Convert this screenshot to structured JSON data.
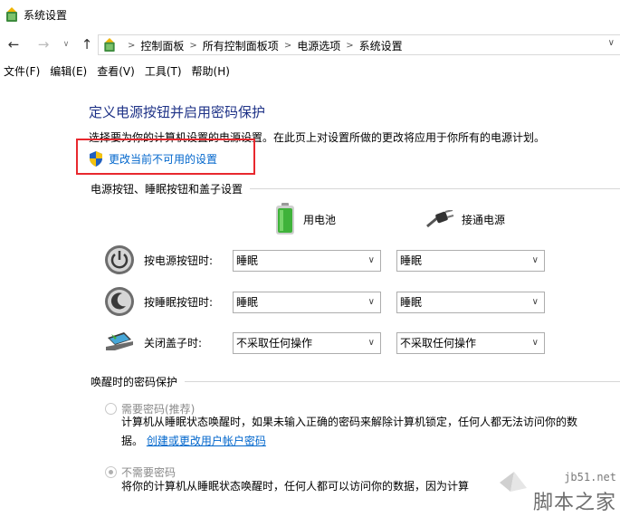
{
  "window": {
    "title": "系统设置"
  },
  "nav": {
    "back": "←",
    "forward": "→",
    "recent": "∨",
    "up": "↑"
  },
  "address": {
    "crumbs": [
      "控制面板",
      "所有控制面板项",
      "电源选项",
      "系统设置"
    ],
    "separator": ">",
    "dropdown": "∨"
  },
  "menu": [
    "文件(F)",
    "编辑(E)",
    "查看(V)",
    "工具(T)",
    "帮助(H)"
  ],
  "page": {
    "title": "定义电源按钮并启用密码保护",
    "description": "选择要为你的计算机设置的电源设置。在此页上对设置所做的更改将应用于你所有的电源计划。",
    "change_link": "更改当前不可用的设置"
  },
  "buttons_section": {
    "heading": "电源按钮、睡眠按钮和盖子设置",
    "col_battery": "用电池",
    "col_plugged": "接通电源",
    "rows": [
      {
        "label": "按电源按钮时:",
        "battery": "睡眠",
        "plugged": "睡眠",
        "icon": "power-icon"
      },
      {
        "label": "按睡眠按钮时:",
        "battery": "睡眠",
        "plugged": "睡眠",
        "icon": "sleep-icon"
      },
      {
        "label": "关闭盖子时:",
        "battery": "不采取任何操作",
        "plugged": "不采取任何操作",
        "icon": "laptop-lid-icon"
      }
    ],
    "dropdown_arrow": "∨"
  },
  "password_section": {
    "heading": "唤醒时的密码保护",
    "option1_label": "需要密码(推荐)",
    "option1_desc_line1": "计算机从睡眠状态唤醒时，如果未输入正确的密码来解除计算机锁定，任何人都无法访问你的数",
    "option1_desc_line2_prefix": "据。",
    "option1_link": "创建或更改用户帐户密码",
    "option2_label": "不需要密码",
    "option2_desc": "将你的计算机从睡眠状态唤醒时，任何人都可以访问你的数据，因为计算"
  },
  "watermark": {
    "url": "jb51.net",
    "name": "脚本之家"
  },
  "colors": {
    "title_blue": "#1e3287",
    "link_blue": "#0066cc",
    "highlight_red": "#e8282e"
  }
}
